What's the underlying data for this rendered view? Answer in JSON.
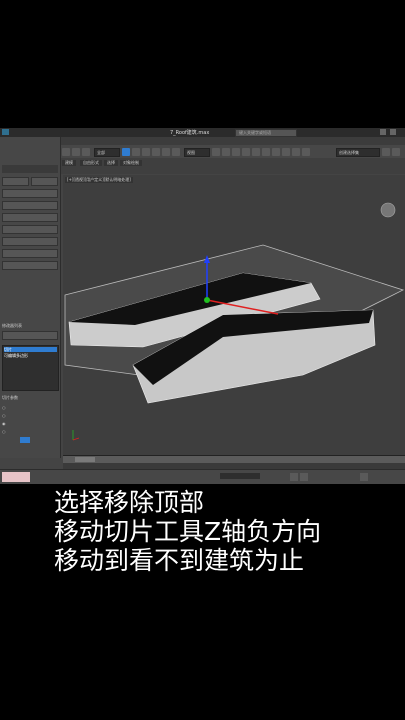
{
  "window": {
    "title": "7_Roof建筑.max",
    "search_placeholder": "键入关键字或短语"
  },
  "left_panel": {
    "modifier_list_label": "修改器列表",
    "modifiers": [
      "切片",
      "可编辑多边形"
    ],
    "section_label": "切片参数"
  },
  "toolbar": {
    "view_combo": "视图",
    "all_combo": "全部",
    "selection_set": "创建选择集"
  },
  "ribbon": {
    "tabs": [
      "建模",
      "自由形式",
      "选择",
      "对象绘制"
    ]
  },
  "viewport": {
    "label": "[+][透视][用户定义][默认明暗处理]"
  },
  "caption": {
    "lines": [
      "选择移除顶部",
      "移动切片工具Z轴负方向",
      "移动到看不到建筑为止"
    ]
  },
  "colors": {
    "accent": "#2f7cd0",
    "axis_x": "#e02020",
    "axis_y": "#20c020",
    "axis_z": "#2040ff"
  }
}
